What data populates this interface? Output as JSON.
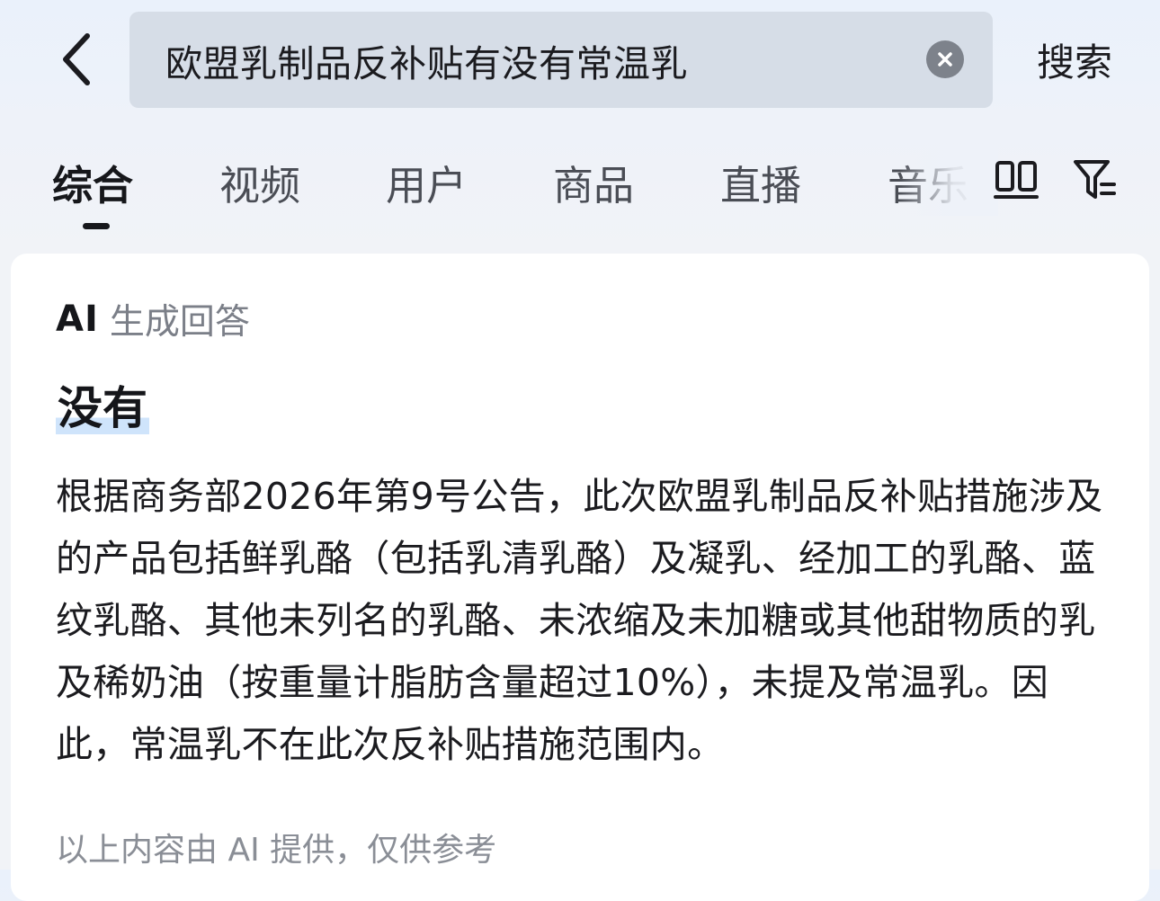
{
  "header": {
    "search": {
      "value": "欧盟乳制品反补贴有没有常温乳"
    },
    "search_button_label": "搜索",
    "back_icon": "chevron-left-icon",
    "clear_icon": "clear-icon"
  },
  "tabs": [
    {
      "label": "综合",
      "active": true
    },
    {
      "label": "视频",
      "active": false
    },
    {
      "label": "用户",
      "active": false
    },
    {
      "label": "商品",
      "active": false
    },
    {
      "label": "直播",
      "active": false
    },
    {
      "label": "音乐",
      "active": false
    }
  ],
  "tab_icons": [
    "layout-icon",
    "filter-icon"
  ],
  "ai_answer": {
    "badge": "AI",
    "label": "生成回答",
    "title": "没有",
    "body": "根据商务部2026年第9号公告，此次欧盟乳制品反补贴措施涉及的产品包括鲜乳酪（包括乳清乳酪）及凝乳、经加工的乳酪、蓝纹乳酪、其他未列名的乳酪、未浓缩及未加糖或其他甜物质的乳及稀奶油（按重量计脂肪含量超过10%），未提及常温乳。因此，常温乳不在此次反补贴措施范围内。",
    "disclaimer": "以上内容由 AI 提供，仅供参考"
  },
  "colors": {
    "accent_dark": "#16171b",
    "search_bg": "#d6dde7",
    "highlight": "#cfe4fb",
    "muted_text": "#7b7f88"
  }
}
